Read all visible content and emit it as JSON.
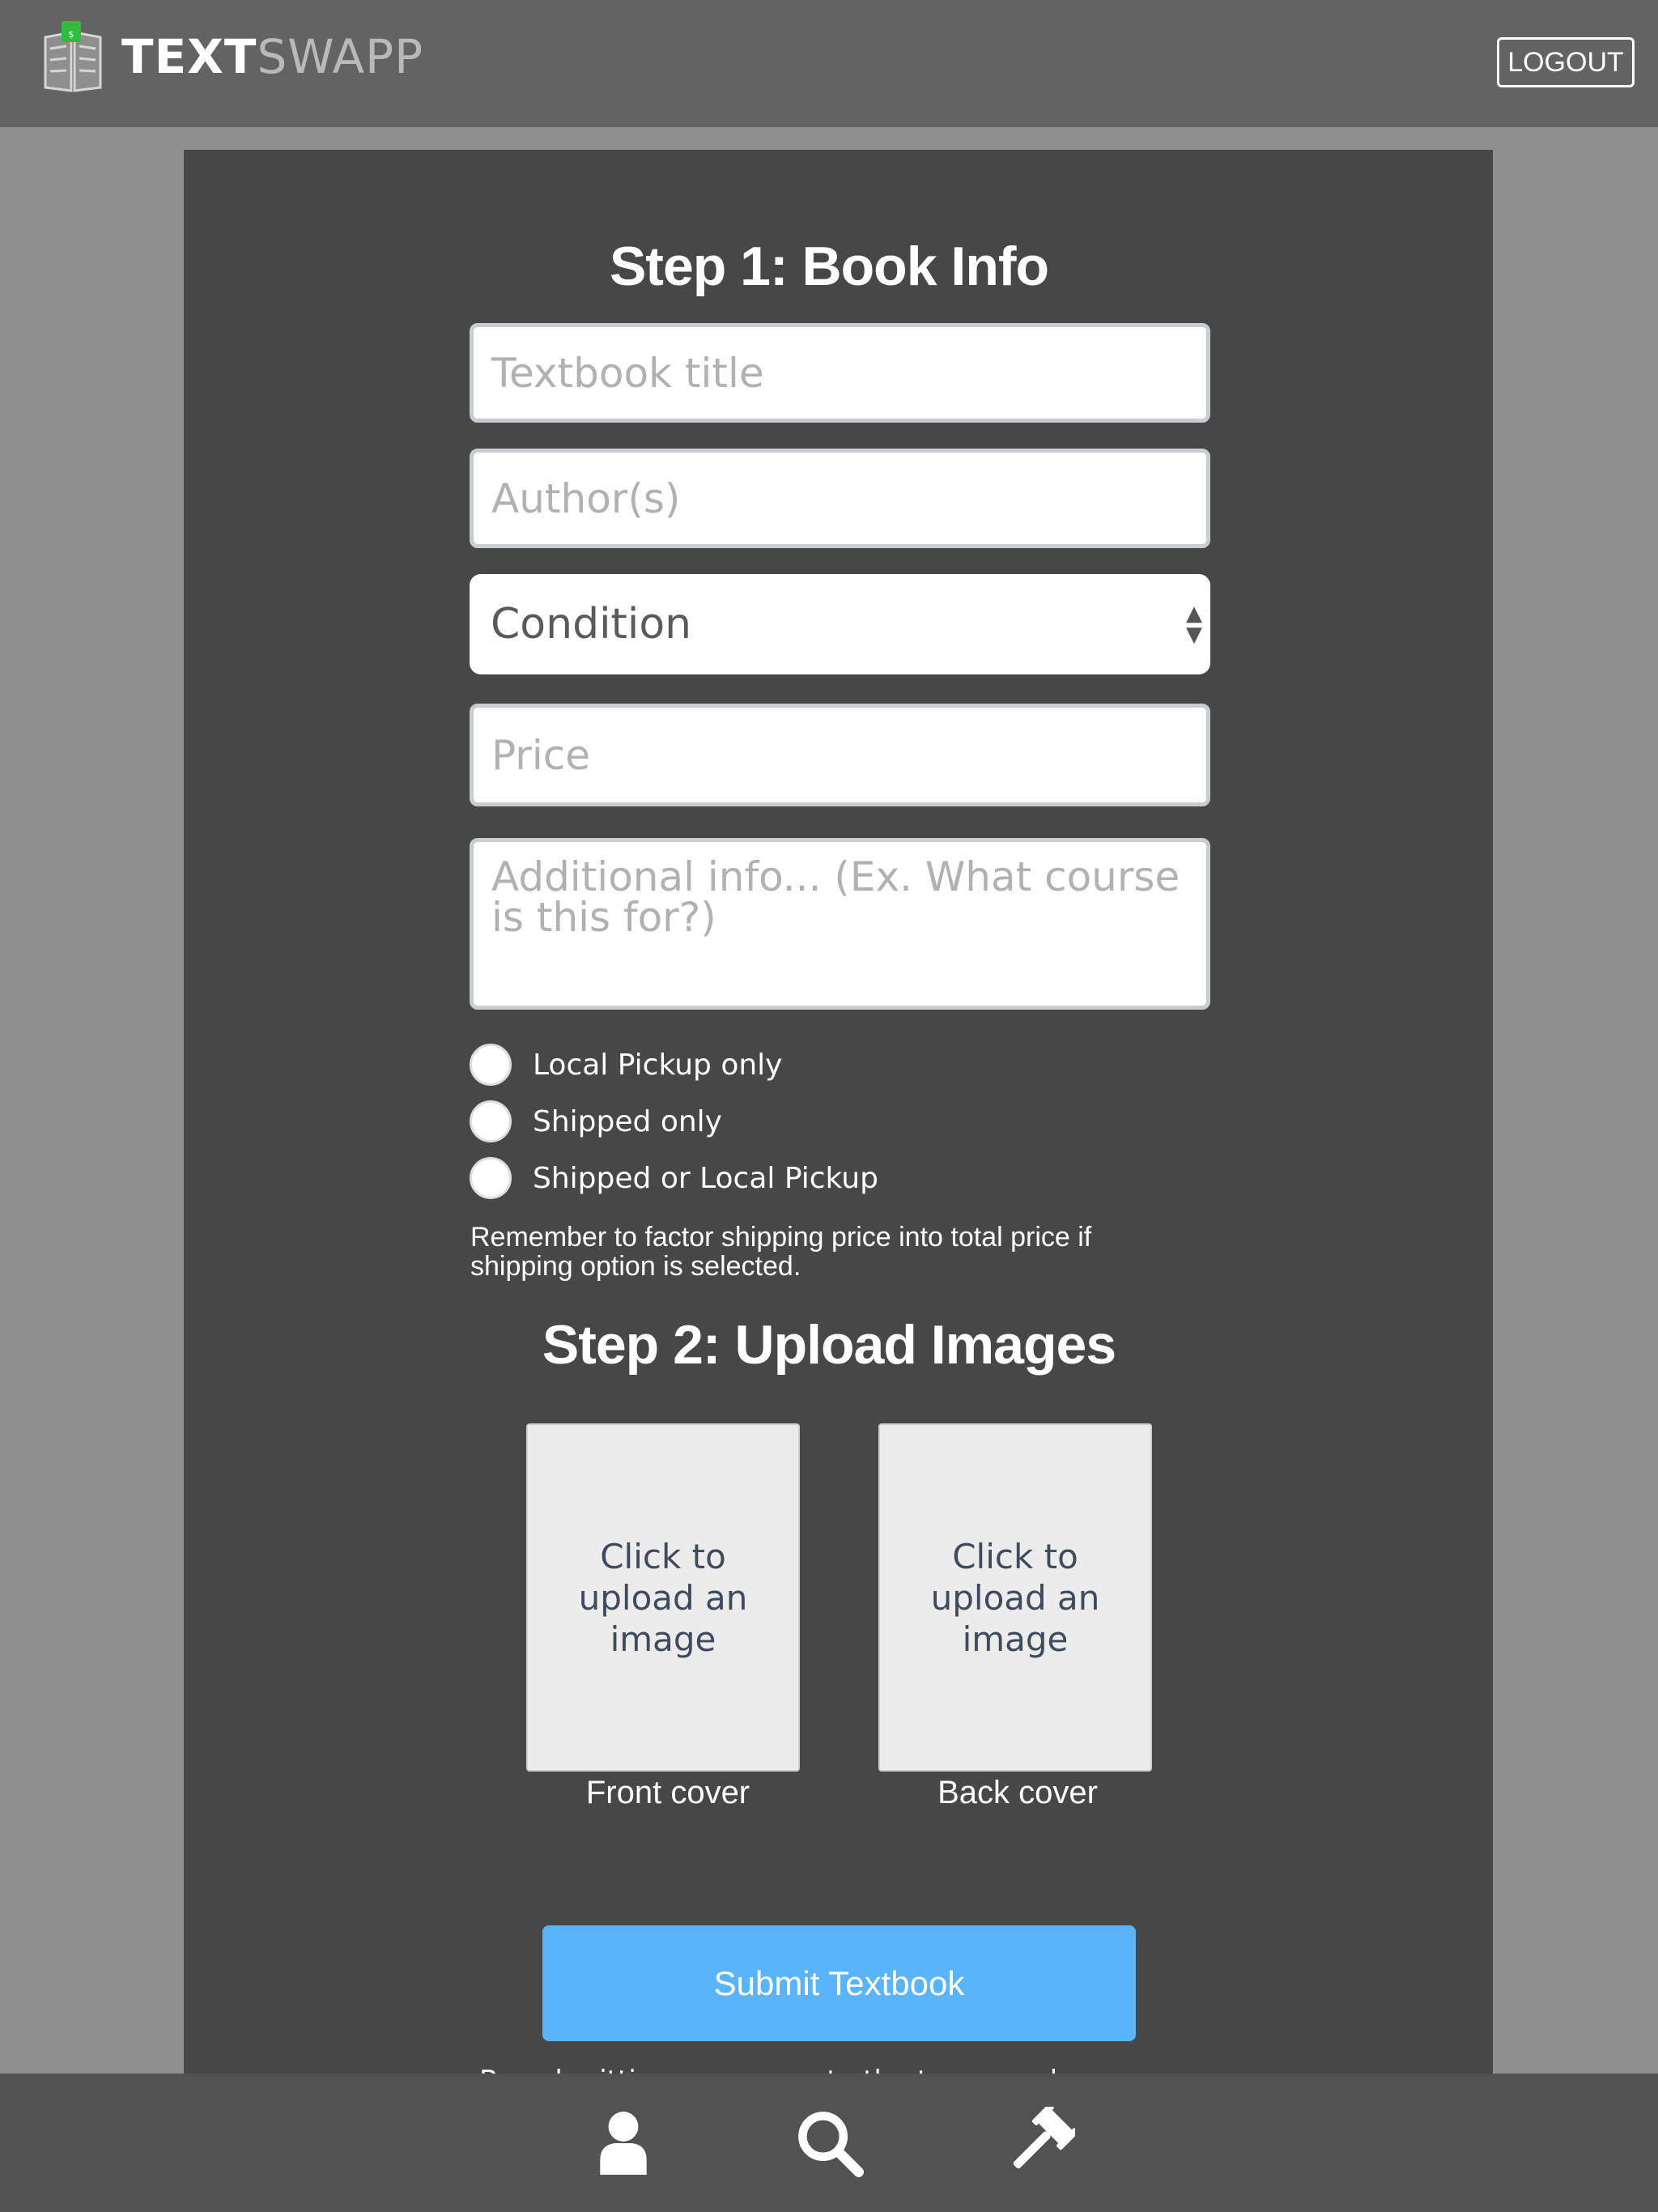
{
  "header": {
    "logo_bold": "TEXT",
    "logo_light": "SWAPP",
    "logout_label": "LOGOUT"
  },
  "step1": {
    "heading": "Step 1: Book Info",
    "title_placeholder": "Textbook title",
    "author_placeholder": "Author(s)",
    "condition_label": "Condition",
    "price_placeholder": "Price",
    "info_placeholder": "Additional info... (Ex. What course is this for?)",
    "shipping_options": [
      "Local Pickup only",
      "Shipped only",
      "Shipped or Local Pickup"
    ],
    "shipping_note": "Remember to factor shipping price into total price if shipping option is selected."
  },
  "step2": {
    "heading": "Step 2: Upload Images",
    "front_upload_text": "Click to upload an image",
    "back_upload_text": "Click to upload an image",
    "front_caption": "Front cover",
    "back_caption": "Back cover"
  },
  "submit_label": "Submit Textbook",
  "terms_text_partial": "By submitting you agree to the terms and agreements",
  "bottom_nav": {
    "icons": [
      "user-icon",
      "search-icon",
      "gavel-icon"
    ]
  },
  "colors": {
    "topbar": "#636363",
    "background": "#8f8f8f",
    "panel": "#474747",
    "bottombar": "#525252",
    "submit": "#5ab4fc",
    "logo_accent": "#2ebd3f"
  }
}
